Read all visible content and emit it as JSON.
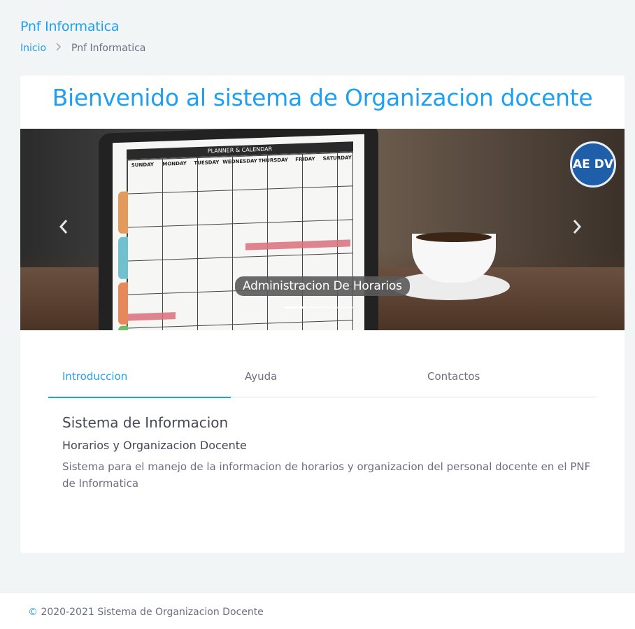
{
  "header": {
    "title": "Pnf Informatica",
    "breadcrumb": {
      "home": "Inicio",
      "separator": ">",
      "current": "Pnf Informatica"
    }
  },
  "main": {
    "welcome_title": "Bienvenido al sistema de Organizacion docente",
    "carousel": {
      "caption": "Administracion De Horarios",
      "logo_text": "AE DV",
      "prev_icon": "chevron-left-icon",
      "next_icon": "chevron-right-icon",
      "planner_title": "PLANNER & CALENDAR",
      "planner_days": [
        "SUNDAY",
        "MONDAY",
        "TUESDAY",
        "WEDNESDAY",
        "THURSDAY",
        "FRIDAY",
        "SATURDAY"
      ]
    },
    "tabs": [
      {
        "label": "Introduccion",
        "active": true
      },
      {
        "label": "Ayuda",
        "active": false
      },
      {
        "label": "Contactos",
        "active": false
      }
    ],
    "content": {
      "title": "Sistema de Informacion",
      "subtitle": "Horarios y Organizacion Docente",
      "text": "Sistema para el manejo de la informacion de horarios y organizacion del personal docente en el PNF de Informatica"
    }
  },
  "footer": {
    "copyright_symbol": "©",
    "text": "2020-2021 Sistema de Organizacion Docente"
  },
  "colors": {
    "accent": "#1e9ff2",
    "text": "#6b6f82",
    "heading": "#464855",
    "background": "#f1f5f6"
  }
}
